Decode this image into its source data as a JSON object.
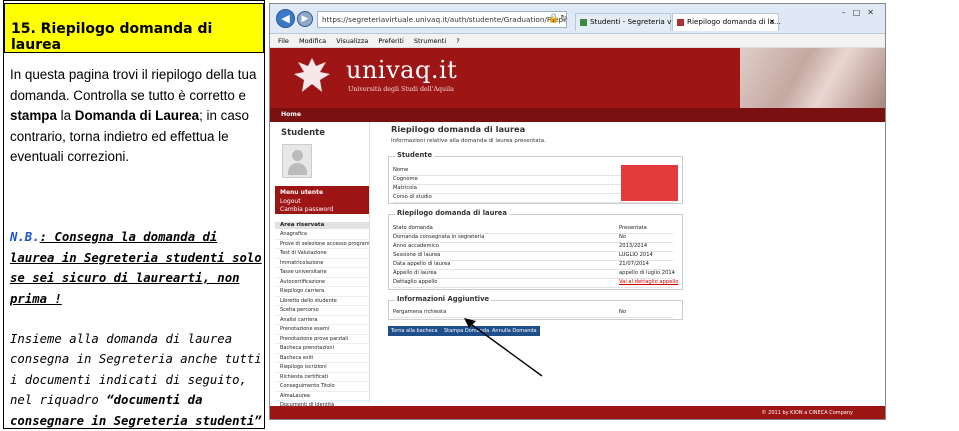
{
  "left": {
    "heading": "15.  Riepilogo domanda di laurea",
    "intro_a": "In questa pagina trovi il riepilogo della tua domanda.",
    "intro_b": "Controlla se tutto è corretto e",
    "intro_stampa": "stampa",
    "intro_la": "la",
    "intro_domanda": "Domanda di Laurea",
    "intro_c": "; in caso contrario, torna indietro ed effettua le eventuali correzioni.",
    "nb_label": "N.B.",
    "nb_text": ": Consegna la domanda di laurea in Segreteria studenti solo se sei sicuro di laurearti, non prima !",
    "together_a": "Insieme alla domanda di laurea consegna in Segreteria anche tutti i documenti indicati di seguito, nel riquadro ",
    "together_b": "“documenti da consegnare in Segreteria studenti”"
  },
  "browser": {
    "url": "https://segreteriavirtuale.univaq.it/auth/studente/Graduation/RiepilogoConsTit.do?stu",
    "tab_1": "Studenti - Segreteria virtuale",
    "tab_2": "Riepilogo domanda di la...",
    "menu": [
      "File",
      "Modifica",
      "Visualizza",
      "Preferiti",
      "Strumenti",
      "?"
    ],
    "logo": "univaq.it",
    "logo_sub": "Università degli Studi dell'Aquila",
    "home": "Home"
  },
  "sidebar": {
    "title": "Studente",
    "menu_title": "Menu utente",
    "menu_items": [
      "Logout",
      "Cambia password"
    ],
    "area_title": "Area riservata",
    "area_items": [
      "Anagrafica",
      "Prove di selezione accesso programmato",
      "Test di Valutazione",
      "Immatricolazione",
      "Tasse universitarie",
      "Autocertificazione",
      "Riepilogo carriera",
      "Libretto dello studente",
      "Scelta percorso",
      "Analisi carriera",
      "Prenotazione esami",
      "Prenotazione prove parziali",
      "Bacheca prenotazioni",
      "Bacheca esiti",
      "Riepilogo iscrizioni",
      "Richiesta certificati",
      "Conseguimento Titolo",
      "AlmaLaurea",
      "Documenti di identità"
    ]
  },
  "content": {
    "title": "Riepilogo domanda di laurea",
    "subtitle": "Informazioni relative alla domanda di laurea presentata.",
    "studente_legend": "Studente",
    "studente_rows": [
      "Nome",
      "Cognome",
      "Matricola",
      "Corso di studio"
    ],
    "riepilogo_legend": "Riepilogo domanda di laurea",
    "riepilogo_rows": [
      {
        "k": "Stato domanda",
        "v": "Presentata"
      },
      {
        "k": "Domanda consegnata in segreteria",
        "v": "No"
      },
      {
        "k": "Anno accademico",
        "v": "2013/2014"
      },
      {
        "k": "Sessione di laurea",
        "v": "LUGLIO 2014"
      },
      {
        "k": "Data appello di laurea",
        "v": "21/07/2014"
      },
      {
        "k": "Appello di laurea",
        "v": "appello di luglio 2014"
      },
      {
        "k": "Dettaglio appello",
        "v": "Vai al dettaglio appello"
      }
    ],
    "info_legend": "Informazioni Aggiuntive",
    "info_rows": [
      {
        "k": "Pergamena richiesta",
        "v": "No"
      }
    ],
    "buttons": [
      "Torna alla bacheca",
      "Stampa Domanda",
      "Annulla Domanda"
    ],
    "footer": "© 2011 by KION a CINECA Company"
  },
  "colors": {
    "brand": "#9e1515",
    "heading_bg": "#ffff00",
    "nb": "#1a52d4",
    "button": "#1f4f8a"
  }
}
